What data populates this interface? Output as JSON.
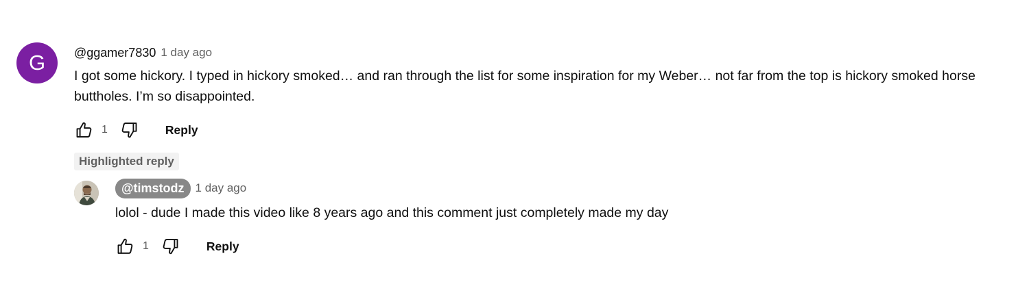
{
  "comment": {
    "avatar_letter": "G",
    "avatar_color": "#7b1fa2",
    "author": "@ggamer7830",
    "time": "1 day ago",
    "text": "I got some hickory. I typed in hickory smoked… and ran through the list for some inspiration for my Weber… not far from the top is hickory smoked horse buttholes. I’m so disappointed.",
    "likes": "1",
    "reply_label": "Reply",
    "like_icon": "thumbs-up-icon",
    "dislike_icon": "thumbs-down-icon"
  },
  "highlight": {
    "label": "Highlighted reply"
  },
  "reply": {
    "author": "@timstodz",
    "time": "1 day ago",
    "text": "lolol - dude I made this video like 8 years ago and this comment just completely made my day",
    "likes": "1",
    "reply_label": "Reply",
    "avatar": "profile-photo"
  }
}
